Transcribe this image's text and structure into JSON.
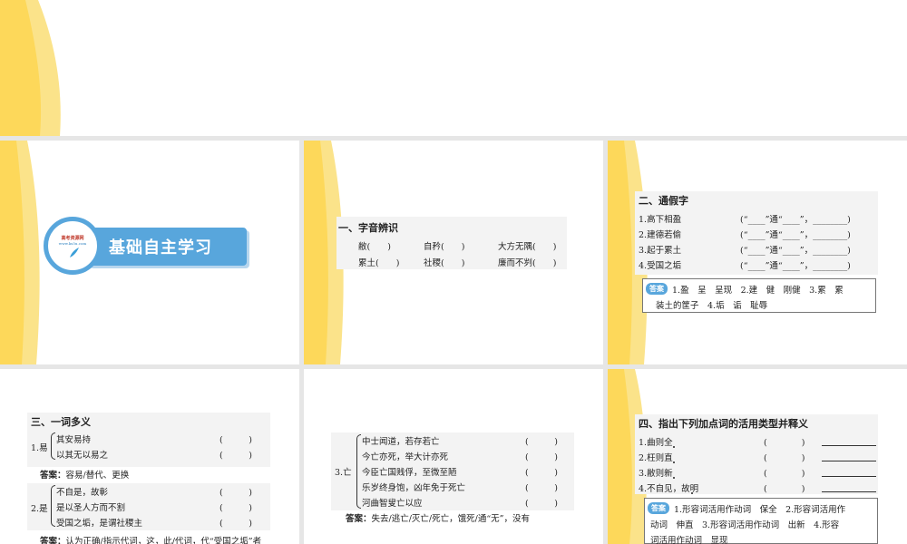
{
  "slide1": {
    "banner": "基础自主学习",
    "logo_top": "高考资源网",
    "logo_bottom": "www.ks5u.com"
  },
  "slide2": {
    "title": "一、字音辨识",
    "row1": [
      "敝(　　)",
      "自矜(　　)",
      "大方无隅(　　)"
    ],
    "row2": [
      "累土(　　)",
      "社稷(　　)",
      "廉而不刿(　　)"
    ]
  },
  "slide3": {
    "title": "二、通假字",
    "items": [
      "1.高下相盈",
      "2.建德若偷",
      "3.起于累土",
      "4.受国之垢"
    ],
    "pattern": "(“____”通“____”，________)",
    "answer_label": "答案",
    "answer_line1": "1.盈　呈　呈现　2.建　健　刚健　3.累　累",
    "answer_line2": "装土的筐子　4.垢　诟　耻辱"
  },
  "slide4": {
    "title": "三、一词多义",
    "g1_label": "1.易",
    "g1_items": [
      "其安易持",
      "以其无以易之"
    ],
    "g1_answer_label": "答案：",
    "g1_answer": "容易/替代、更换",
    "g2_label": "2.是",
    "g2_items": [
      "不自是，故彰",
      "是以圣人方而不割",
      "受国之垢，是谓社稷主"
    ],
    "g2_answer_label": "答案：",
    "g2_answer": "认为正确/指示代词，这，此/代词，代“受国之垢”者",
    "paren": "(　　　)"
  },
  "slide5": {
    "label": "3.亡",
    "items": [
      "中士闻道，若存若亡",
      "今亡亦死，举大计亦死",
      "今臣亡国贱俘，至微至陋",
      "乐岁终身饱，凶年免于死亡",
      "河曲智叟亡以应"
    ],
    "paren": "(　　　)",
    "answer_label": "答案：",
    "answer": "失去/逃亡/灭亡/死亡，饿死/通“无”，没有"
  },
  "slide6": {
    "title": "四、指出下列加点词的活用类型并释义",
    "items": [
      "1.曲则全",
      "2.枉则直",
      "3.敝则新",
      "4.不自见，故明"
    ],
    "paren": "(　　　　)",
    "answer_label": "答案",
    "answer_line1": "1.形容词活用作动词　保全　2.形容词活用作",
    "answer_line2": "动词　伸直　3.形容词活用作动词　出新　4.形容",
    "answer_line3": "词活用作动词　显现"
  }
}
